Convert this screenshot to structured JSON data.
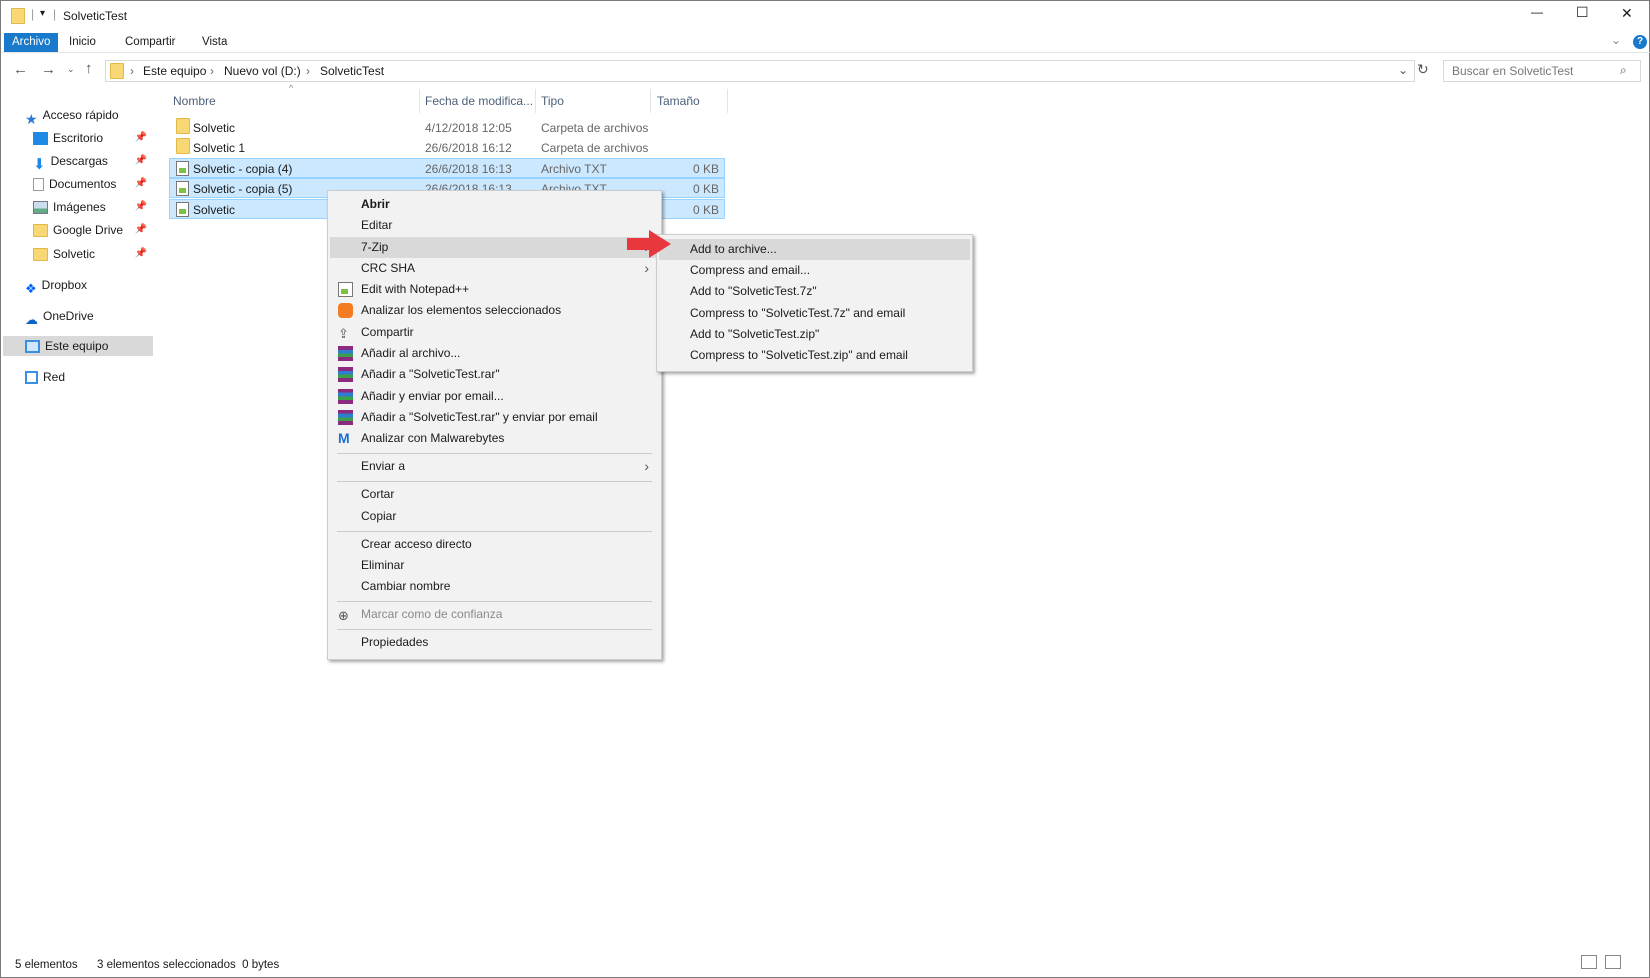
{
  "window": {
    "title": "SolveticTest",
    "minimize": "—",
    "maximize": "☐",
    "close": "✕",
    "help": "?"
  },
  "ribbon": {
    "tabs": [
      "Archivo",
      "Inicio",
      "Compartir",
      "Vista"
    ],
    "expand": "⌄"
  },
  "address": {
    "crumbs": [
      "Este equipo",
      "Nuevo vol (D:)",
      "SolveticTest"
    ],
    "search_placeholder": "Buscar en SolveticTest"
  },
  "sidebar": {
    "items": [
      {
        "label": "Acceso rápido",
        "color": "#2a7bd3"
      },
      {
        "label": "Escritorio",
        "color": "#1e88e5",
        "pinned": true
      },
      {
        "label": "Descargas",
        "color": "#1e88e5",
        "pinned": true
      },
      {
        "label": "Documentos",
        "color": "#aab",
        "pinned": true
      },
      {
        "label": "Imágenes",
        "color": "#6a8",
        "pinned": true
      },
      {
        "label": "Google Drive",
        "color": "#f8d775",
        "pinned": true
      },
      {
        "label": "Solvetic",
        "color": "#f8d775",
        "pinned": true
      },
      {
        "label": "Dropbox",
        "color": "#0061fe"
      },
      {
        "label": "OneDrive",
        "color": "#0a64c8"
      },
      {
        "label": "Este equipo",
        "color": "#3b8ee0"
      },
      {
        "label": "Red",
        "color": "#3b8ee0"
      }
    ]
  },
  "columns": [
    "Nombre",
    "Fecha de modifica...",
    "Tipo",
    "Tamaño"
  ],
  "files": [
    {
      "name": "Solvetic",
      "date": "4/12/2018 12:05",
      "type": "Carpeta de archivos",
      "size": ""
    },
    {
      "name": "Solvetic 1",
      "date": "26/6/2018 16:12",
      "type": "Carpeta de archivos",
      "size": ""
    },
    {
      "name": "Solvetic - copia (4)",
      "date": "26/6/2018 16:13",
      "type": "Archivo TXT",
      "size": "0 KB"
    },
    {
      "name": "Solvetic - copia (5)",
      "date": "26/6/2018 16:13",
      "type": "Archivo TXT",
      "size": "0 KB"
    },
    {
      "name": "Solvetic",
      "date": "",
      "type": "",
      "size": "0 KB"
    }
  ],
  "context_menu": [
    "Abrir",
    "Editar",
    "7-Zip",
    "CRC SHA",
    "Edit with Notepad++",
    "Analizar los elementos seleccionados",
    "Compartir",
    "Añadir al archivo...",
    "Añadir a \"SolveticTest.rar\"",
    "Añadir y enviar por email...",
    "Añadir a \"SolveticTest.rar\" y enviar por email",
    "Analizar con Malwarebytes",
    "Enviar a",
    "Cortar",
    "Copiar",
    "Crear acceso directo",
    "Eliminar",
    "Cambiar nombre",
    "Marcar como de confianza",
    "Propiedades"
  ],
  "submenu": [
    "Add to archive...",
    "Compress and email...",
    "Add to \"SolveticTest.7z\"",
    "Compress to \"SolveticTest.7z\" and email",
    "Add to \"SolveticTest.zip\"",
    "Compress to \"SolveticTest.zip\" and email"
  ],
  "status": {
    "count": "5 elementos",
    "selection": "3 elementos seleccionados  0 bytes"
  }
}
